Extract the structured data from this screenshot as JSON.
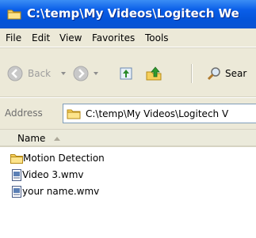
{
  "window": {
    "title": "C:\\temp\\My Videos\\Logitech We"
  },
  "menu": {
    "items": [
      "File",
      "Edit",
      "View",
      "Favorites",
      "Tools"
    ]
  },
  "toolbar": {
    "back_label": "Back",
    "search_label": "Sear"
  },
  "address": {
    "label": "Address",
    "path": "C:\\temp\\My Videos\\Logitech V"
  },
  "columns": {
    "name": "Name"
  },
  "files": [
    {
      "name": "Motion Detection",
      "type": "folder"
    },
    {
      "name": "Video 3.wmv",
      "type": "file"
    },
    {
      "name": "your name.wmv",
      "type": "file"
    }
  ],
  "icons": [
    "folder-icon",
    "back-icon",
    "forward-icon",
    "up-icon",
    "sync-icon",
    "search-icon",
    "file-icon"
  ]
}
